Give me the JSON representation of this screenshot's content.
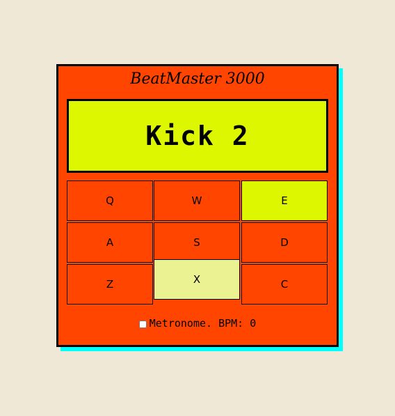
{
  "app": {
    "title": "BeatMaster 3000"
  },
  "display": {
    "text": "Kick 2"
  },
  "pads": [
    {
      "key": "Q"
    },
    {
      "key": "W"
    },
    {
      "key": "E"
    },
    {
      "key": "A"
    },
    {
      "key": "S"
    },
    {
      "key": "D"
    },
    {
      "key": "Z"
    },
    {
      "key": "X"
    },
    {
      "key": "C"
    }
  ],
  "metronome": {
    "label": "Metronome. BPM: 0",
    "checked": false
  },
  "colors": {
    "background": "#efe8d6",
    "machine": "#ff4500",
    "display": "#ddf700",
    "active_pad": "#ddf700",
    "pressed_pad": "#eaf292",
    "shadow": "#00ffff"
  }
}
